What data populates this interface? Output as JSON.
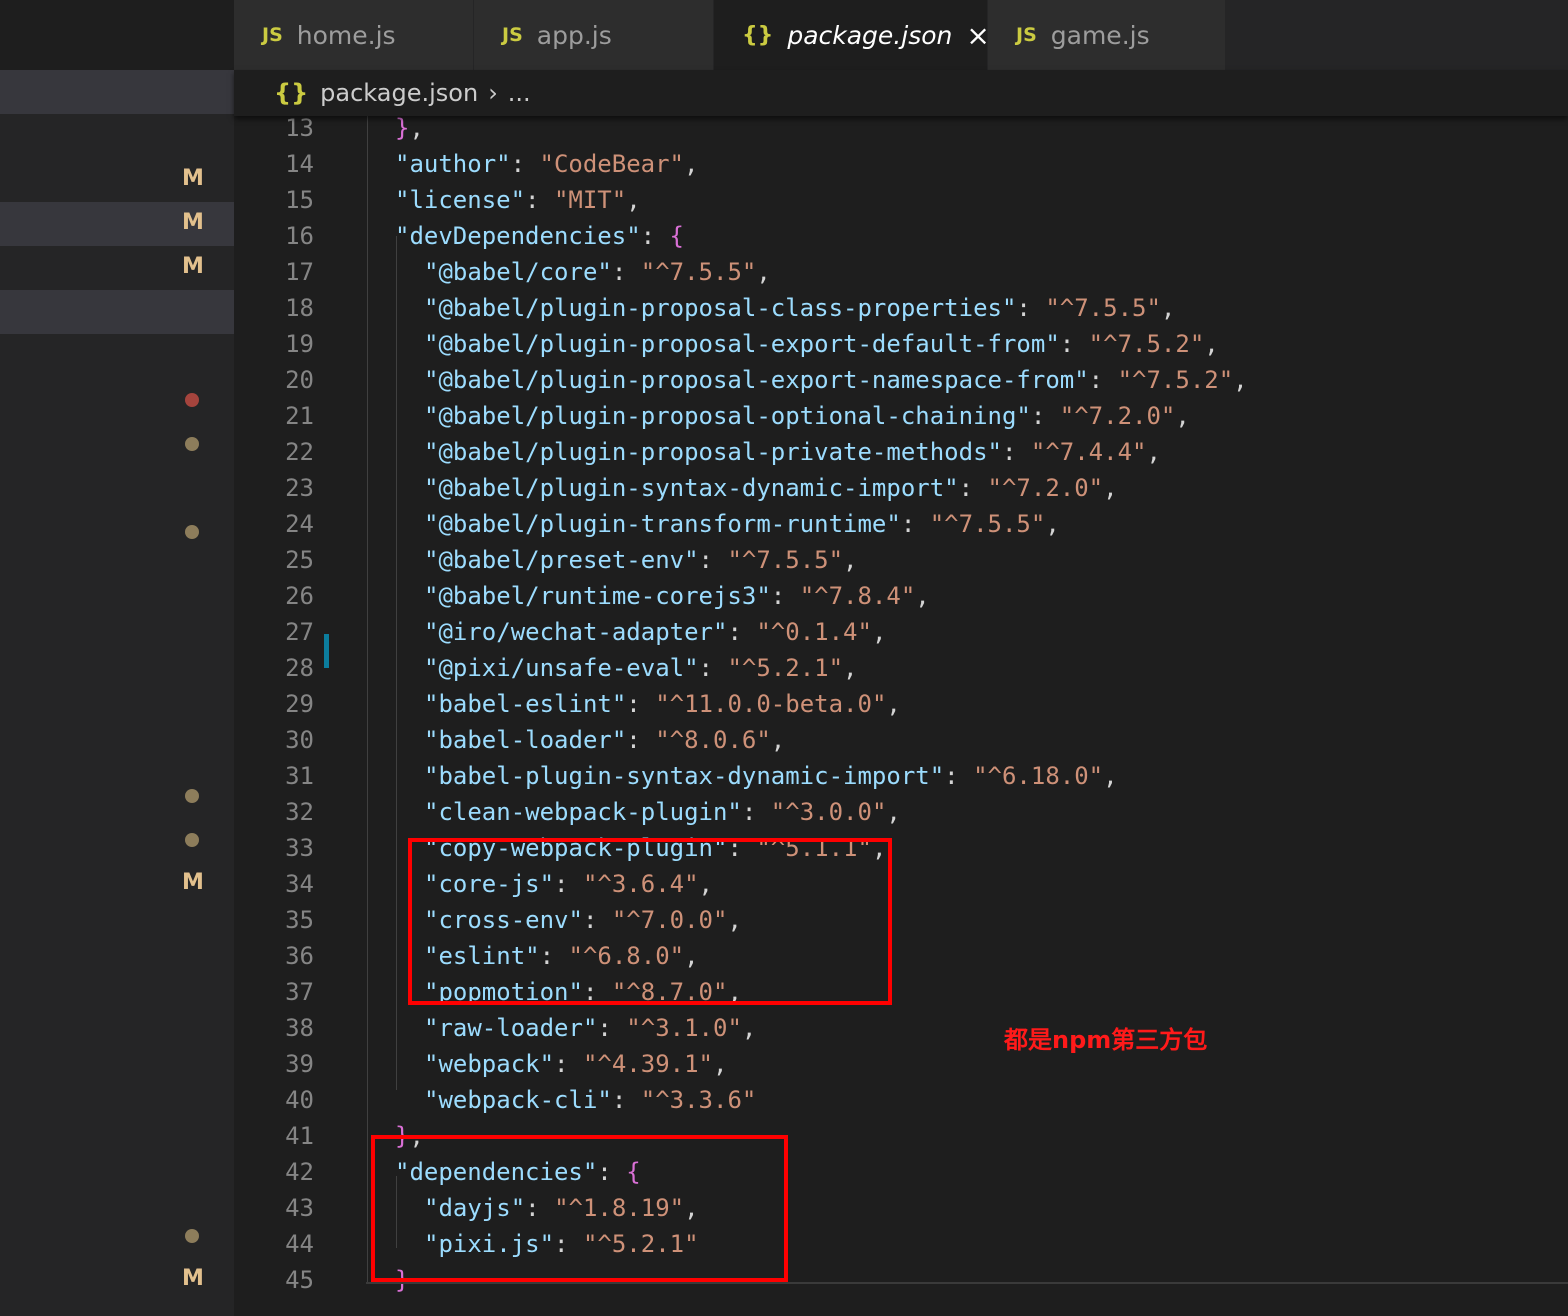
{
  "tabs": [
    {
      "label": "home.js",
      "icon": "JS"
    },
    {
      "label": "app.js",
      "icon": "JS"
    },
    {
      "label": "package.json",
      "icon": "{}"
    },
    {
      "label": "game.js",
      "icon": "JS"
    }
  ],
  "breadcrumb": {
    "file": "package.json",
    "rest": "..."
  },
  "sidebar": {
    "markers": [
      "M",
      "M",
      "M",
      "M",
      "M"
    ]
  },
  "annotation": {
    "note": "都是npm第三方包"
  },
  "code_lines": [
    {
      "n": "13",
      "indent": 1,
      "close": "},",
      "clipped": true
    },
    {
      "n": "14",
      "indent": 1,
      "key": "author",
      "value": "CodeBear",
      "trail": ","
    },
    {
      "n": "15",
      "indent": 1,
      "key": "license",
      "value": "MIT",
      "trail": ","
    },
    {
      "n": "16",
      "indent": 1,
      "key": "devDependencies",
      "open": "{"
    },
    {
      "n": "17",
      "indent": 2,
      "key": "@babel/core",
      "value": "^7.5.5",
      "trail": ","
    },
    {
      "n": "18",
      "indent": 2,
      "key": "@babel/plugin-proposal-class-properties",
      "value": "^7.5.5",
      "trail": ","
    },
    {
      "n": "19",
      "indent": 2,
      "key": "@babel/plugin-proposal-export-default-from",
      "value": "^7.5.2",
      "trail": ","
    },
    {
      "n": "20",
      "indent": 2,
      "key": "@babel/plugin-proposal-export-namespace-from",
      "value": "^7.5.2",
      "trail": ","
    },
    {
      "n": "21",
      "indent": 2,
      "key": "@babel/plugin-proposal-optional-chaining",
      "value": "^7.2.0",
      "trail": ","
    },
    {
      "n": "22",
      "indent": 2,
      "key": "@babel/plugin-proposal-private-methods",
      "value": "^7.4.4",
      "trail": ","
    },
    {
      "n": "23",
      "indent": 2,
      "key": "@babel/plugin-syntax-dynamic-import",
      "value": "^7.2.0",
      "trail": ","
    },
    {
      "n": "24",
      "indent": 2,
      "key": "@babel/plugin-transform-runtime",
      "value": "^7.5.5",
      "trail": ","
    },
    {
      "n": "25",
      "indent": 2,
      "key": "@babel/preset-env",
      "value": "^7.5.5",
      "trail": ","
    },
    {
      "n": "26",
      "indent": 2,
      "key": "@babel/runtime-corejs3",
      "value": "^7.8.4",
      "trail": ","
    },
    {
      "n": "27",
      "indent": 2,
      "key": "@iro/wechat-adapter",
      "value": "^0.1.4",
      "trail": ","
    },
    {
      "n": "28",
      "indent": 2,
      "key": "@pixi/unsafe-eval",
      "value": "^5.2.1",
      "trail": ","
    },
    {
      "n": "29",
      "indent": 2,
      "key": "babel-eslint",
      "value": "^11.0.0-beta.0",
      "trail": ","
    },
    {
      "n": "30",
      "indent": 2,
      "key": "babel-loader",
      "value": "^8.0.6",
      "trail": ","
    },
    {
      "n": "31",
      "indent": 2,
      "key": "babel-plugin-syntax-dynamic-import",
      "value": "^6.18.0",
      "trail": ","
    },
    {
      "n": "32",
      "indent": 2,
      "key": "clean-webpack-plugin",
      "value": "^3.0.0",
      "trail": ","
    },
    {
      "n": "33",
      "indent": 2,
      "key": "copy-webpack-plugin",
      "value": "^5.1.1",
      "trail": ","
    },
    {
      "n": "34",
      "indent": 2,
      "key": "core-js",
      "value": "^3.6.4",
      "trail": ","
    },
    {
      "n": "35",
      "indent": 2,
      "key": "cross-env",
      "value": "^7.0.0",
      "trail": ","
    },
    {
      "n": "36",
      "indent": 2,
      "key": "eslint",
      "value": "^6.8.0",
      "trail": ","
    },
    {
      "n": "37",
      "indent": 2,
      "key": "popmotion",
      "value": "^8.7.0",
      "trail": ","
    },
    {
      "n": "38",
      "indent": 2,
      "key": "raw-loader",
      "value": "^3.1.0",
      "trail": ","
    },
    {
      "n": "39",
      "indent": 2,
      "key": "webpack",
      "value": "^4.39.1",
      "trail": ","
    },
    {
      "n": "40",
      "indent": 2,
      "key": "webpack-cli",
      "value": "^3.3.6",
      "trail": ""
    },
    {
      "n": "41",
      "indent": 1,
      "close": "},"
    },
    {
      "n": "42",
      "indent": 1,
      "key": "dependencies",
      "open": "{"
    },
    {
      "n": "43",
      "indent": 2,
      "key": "dayjs",
      "value": "^1.8.19",
      "trail": ","
    },
    {
      "n": "44",
      "indent": 2,
      "key": "pixi.js",
      "value": "^5.2.1",
      "trail": ""
    },
    {
      "n": "45",
      "indent": 1,
      "close": "}"
    }
  ]
}
